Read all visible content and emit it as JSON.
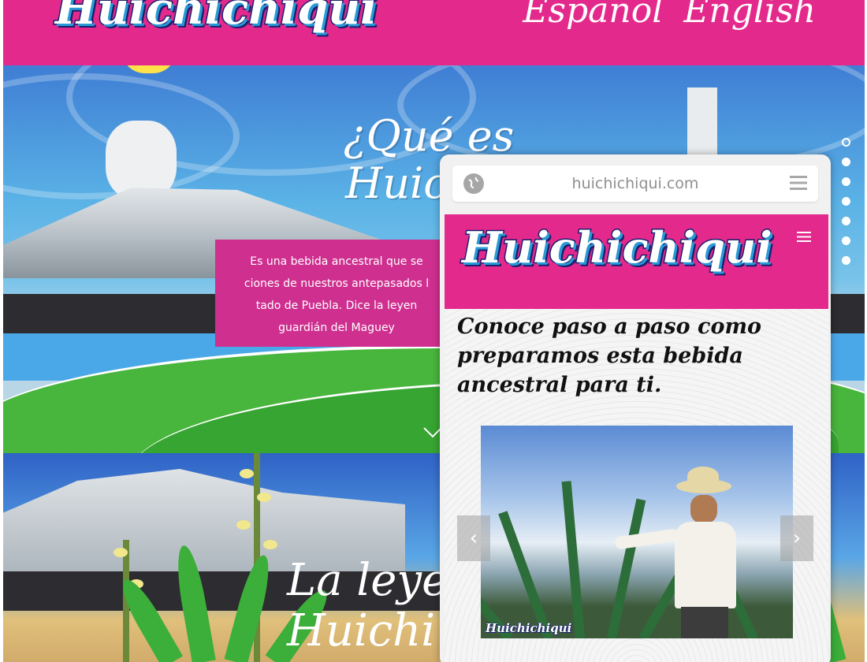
{
  "header": {
    "logo": "Huichichiqui",
    "lang_es": "Español",
    "lang_en": "English"
  },
  "hero": {
    "title_line1": "¿Qué es",
    "title_line2": "Huichic",
    "text_line1": "Es una bebida ancestral que se",
    "text_line2": "ciones de nuestros antepasados l",
    "text_line3": "tado de Puebla. Dice la leyen",
    "text_line4": "guardián del Maguey",
    "scroll_icon": "chevron-down-icon"
  },
  "nav_dots": {
    "count": 7,
    "active_index": 0
  },
  "section2": {
    "title_line1": "La leyen",
    "title_line2": "Huichi"
  },
  "mobile": {
    "url": "huichichiqui.com",
    "logo": "Huichichiqui",
    "heading": "Conoce paso a paso como preparamos esta bebida ancestral para ti.",
    "photo_watermark": "Huichichiqui",
    "prev_label": "‹",
    "next_label": "›"
  },
  "colors": {
    "brand_pink": "#e4298c",
    "text_box_pink": "#cf2f8f",
    "logo_navy": "#1a1f6e"
  }
}
